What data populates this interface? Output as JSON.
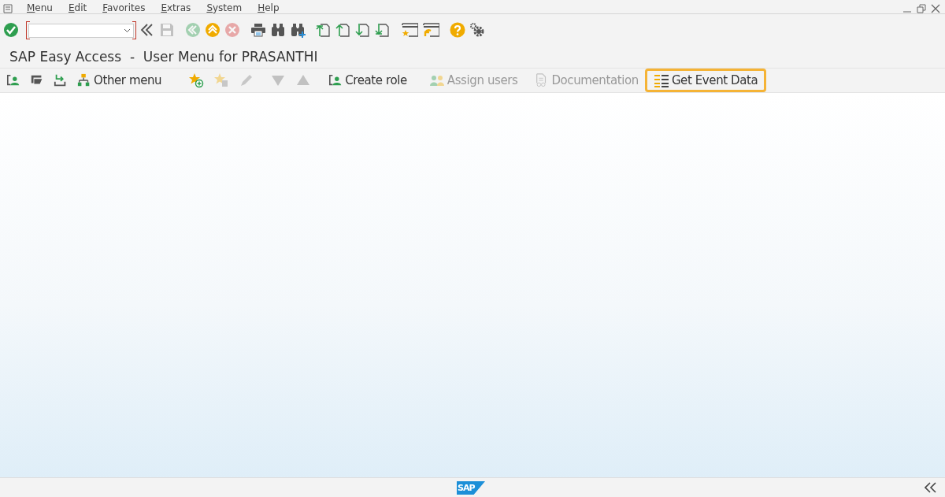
{
  "menu_bar": [
    {
      "label": "Menu"
    },
    {
      "label": "Edit"
    },
    {
      "label": "Favorites"
    },
    {
      "label": "Extras"
    },
    {
      "label": "System"
    },
    {
      "label": "Help"
    }
  ],
  "system_toolbar": [
    {
      "kind": "enter",
      "disabled": false
    },
    {
      "kind": "command"
    },
    {
      "kind": "collapse",
      "disabled": false
    },
    {
      "kind": "save",
      "disabled": true
    },
    {
      "kind": "back",
      "disabled": true
    },
    {
      "kind": "exit",
      "disabled": false
    },
    {
      "kind": "cancel",
      "disabled": true
    },
    {
      "kind": "print",
      "disabled": false
    },
    {
      "kind": "find",
      "disabled": false
    },
    {
      "kind": "findnext",
      "disabled": false
    },
    {
      "kind": "first",
      "disabled": false
    },
    {
      "kind": "prev",
      "disabled": false
    },
    {
      "kind": "next",
      "disabled": false
    },
    {
      "kind": "last",
      "disabled": false
    },
    {
      "kind": "newsession",
      "disabled": false
    },
    {
      "kind": "shortcut",
      "disabled": false
    },
    {
      "kind": "help",
      "disabled": false
    },
    {
      "kind": "settings",
      "disabled": false
    }
  ],
  "title": "SAP Easy Access  -  User Menu for PRASANTHI",
  "app_toolbar": [
    {
      "kind": "usermenu",
      "disabled": false,
      "highlighted": false
    },
    {
      "kind": "sapmenu",
      "disabled": false,
      "highlighted": false
    },
    {
      "kind": "workplace",
      "disabled": false,
      "highlighted": false
    },
    {
      "kind": "othermenu",
      "label": "Other menu",
      "disabled": false,
      "highlighted": false
    },
    {
      "kind": "addfav",
      "disabled": false,
      "highlighted": false
    },
    {
      "kind": "delfav",
      "disabled": true,
      "highlighted": false
    },
    {
      "kind": "edit",
      "disabled": true,
      "highlighted": false
    },
    {
      "kind": "down",
      "disabled": true,
      "highlighted": false
    },
    {
      "kind": "up",
      "disabled": true,
      "highlighted": false
    },
    {
      "kind": "createrole",
      "label": "Create role",
      "disabled": false,
      "highlighted": false
    },
    {
      "kind": "assign",
      "label": "Assign users",
      "disabled": true,
      "highlighted": false
    },
    {
      "kind": "doc",
      "label": "Documentation",
      "disabled": true,
      "highlighted": false
    },
    {
      "kind": "list",
      "label": "Get Event Data",
      "disabled": false,
      "highlighted": true
    }
  ],
  "status_bar": {
    "logo": "SAP"
  }
}
